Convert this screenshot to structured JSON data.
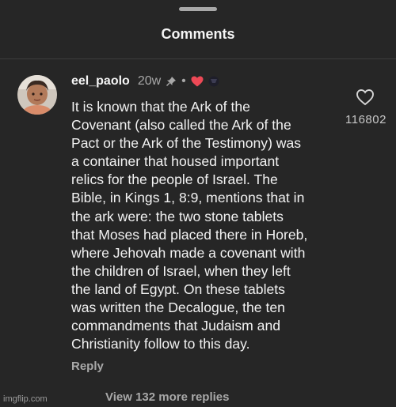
{
  "sheet": {
    "title": "Comments"
  },
  "comment": {
    "username": "eel_paolo",
    "time": "20w",
    "separator": "•",
    "text": "It is known that the Ark of the\nCovenant (also called the Ark of the\nPact or the Ark of the Testimony) was\na container that housed important\nrelics for the people of Israel. The\nBible, in Kings 1, 8:9, mentions that in\nthe ark were: the two stone tablets\nthat Moses had placed there in Horeb,\nwhere Jehovah made a covenant with\nthe children of Israel, when they left\nthe land of Egypt. On these tablets\nwas written the Decalogue, the ten\ncommandments that Judaism and\nChristianity follow to this day.",
    "reply_label": "Reply",
    "like_count": "116802",
    "view_more_label": "View 132 more replies"
  },
  "watermark": "imgflip.com",
  "icons": {
    "pin": "pin-icon",
    "creator_liked": "heart-icon",
    "like": "heart-outline-icon"
  },
  "colors": {
    "background": "#262626",
    "creator_heart": "#ed4956",
    "secondary_text": "#a8a8a8"
  }
}
